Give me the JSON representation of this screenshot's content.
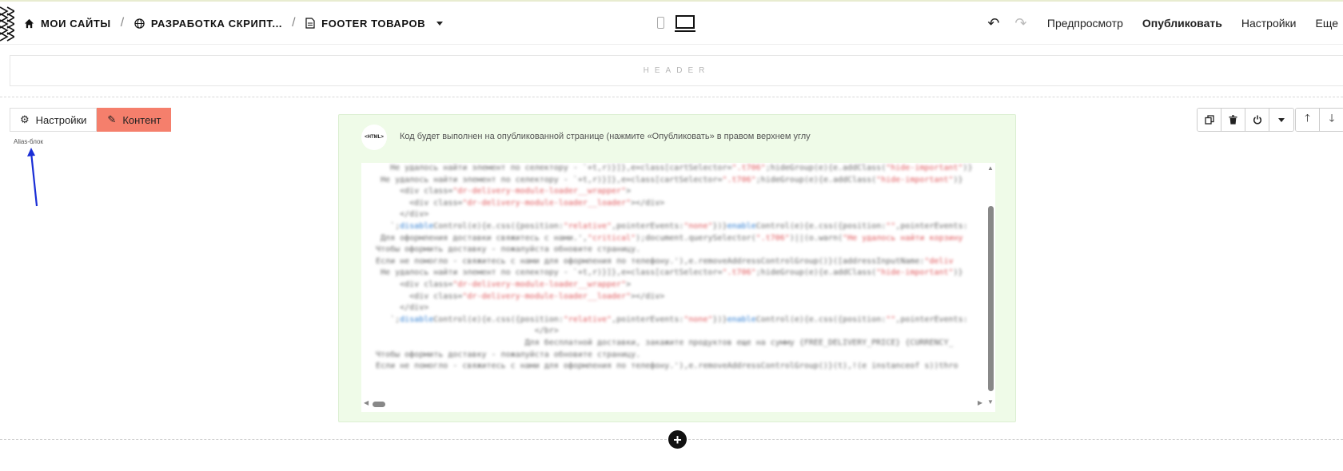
{
  "breadcrumbs": {
    "sites": "МОИ САЙТЫ",
    "project": "РАЗРАБОТКА СКРИПТ...",
    "page": "FOOTER ТОВАРОВ"
  },
  "icons": {
    "home": "home-icon",
    "globe": "globe-icon",
    "page": "page-icon",
    "phone": "mobile-view-icon",
    "desktop": "desktop-view-icon",
    "undo": "undo-icon",
    "redo": "redo-icon"
  },
  "menu": {
    "preview": "Предпросмотр",
    "publish": "Опубликовать",
    "settings": "Настройки",
    "more": "Еще"
  },
  "header_placeholder": "HEADER",
  "tabs": {
    "settings": "Настройки",
    "content": "Контент"
  },
  "alias_label": "Alias-блок",
  "html_block": {
    "badge": "<HTML>",
    "notice": "Код будет выполнен на опубликованной странице (нажмите «Опубликовать» в правом верхнем углу"
  },
  "colors": {
    "accent": "#f57f6c",
    "block_bg": "#effbe8",
    "arrow": "#1a2ed6"
  }
}
